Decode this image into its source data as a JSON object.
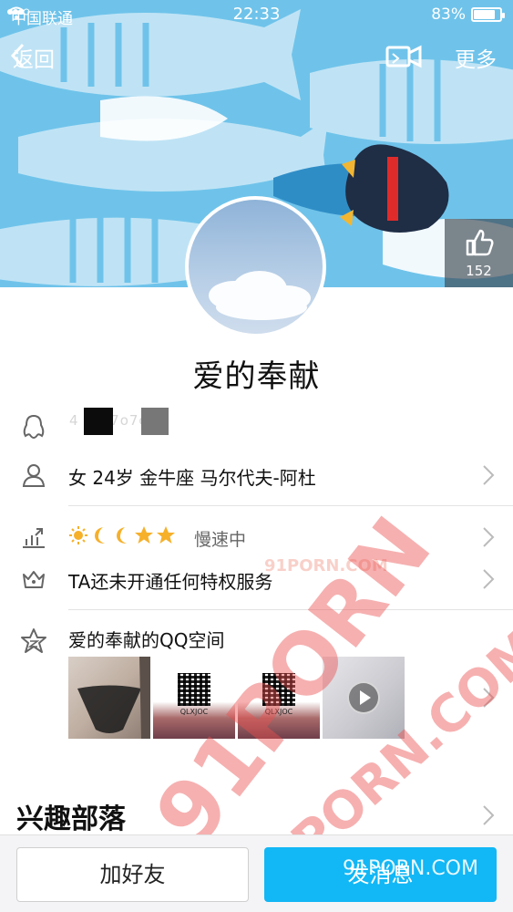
{
  "status_bar": {
    "carrier": "中国联通",
    "time": "22:33",
    "battery": "83%",
    "battery_level": 0.83
  },
  "nav": {
    "back_label": "返回",
    "more_label": "更多"
  },
  "likes": {
    "count": "152"
  },
  "profile": {
    "nickname": "爱的奉献",
    "qq_number_faint": "4 ·····7o7o",
    "info": "女 24岁 金牛座 马尔代夫-阿杜",
    "level_status": "慢速中",
    "privilege": "TA还未开通任何特权服务",
    "qzone_title": "爱的奉献的QQ空间",
    "qzone_thumbs": [
      {
        "kind": "photo"
      },
      {
        "kind": "qr",
        "label": "QLXJOC"
      },
      {
        "kind": "qr",
        "label": "QLXJOC"
      },
      {
        "kind": "video"
      }
    ]
  },
  "sections": {
    "interest": "兴趣部落"
  },
  "actions": {
    "add_friend": "加好友",
    "send_message": "发消息"
  },
  "watermarks": {
    "big": "91PORN",
    "small": "91PORN.COM",
    "faint": "91PORN.COM",
    "bottom": "91PORN.COM"
  },
  "colors": {
    "accent": "#12b7f5",
    "banner": "#6fc3ea"
  }
}
